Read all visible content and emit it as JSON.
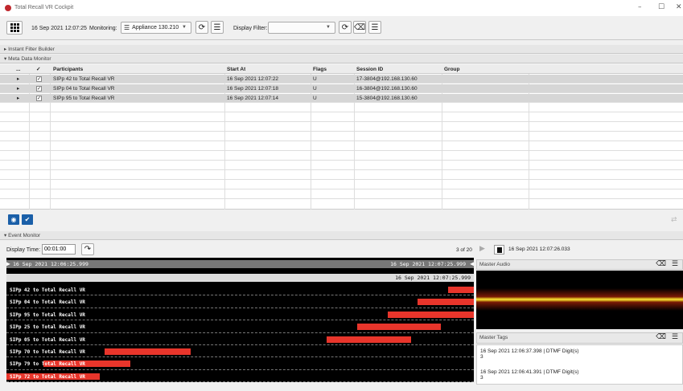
{
  "window": {
    "title": "Total Recall VR Cockpit",
    "minimize": "–",
    "maximize": "☐",
    "close": "✕"
  },
  "toolbar": {
    "datetime": "16 Sep 2021 12:07:25",
    "monitoring_label": "Monitoring:",
    "monitoring_value": "Appliance 130.210",
    "display_filter_label": "Display Filter:",
    "display_filter_value": ""
  },
  "sections": {
    "instant_filter": "Instant Filter Builder",
    "meta_monitor": "Meta Data Monitor",
    "event_monitor": "Event Monitor"
  },
  "table": {
    "headers": {
      "dots": "...",
      "check": "✓",
      "participants": "Participants",
      "start": "Start At",
      "flags": "Flags",
      "session": "Session ID",
      "group": "Group"
    },
    "rows": [
      {
        "expand": "▸",
        "check": "✓",
        "participants": "SIPp 42 to Total Recall VR",
        "start": "16 Sep 2021 12:07:22",
        "flags": "U",
        "session": "17-3804@192.168.130.60",
        "group": ""
      },
      {
        "expand": "▸",
        "check": "✓",
        "participants": "SIPp 04 to Total Recall VR",
        "start": "16 Sep 2021 12:07:18",
        "flags": "U",
        "session": "16-3804@192.168.130.60",
        "group": ""
      },
      {
        "expand": "▸",
        "check": "✓",
        "participants": "SIPp 95 to Total Recall VR",
        "start": "16 Sep 2021 12:07:14",
        "flags": "U",
        "session": "15-3804@192.168.130.60",
        "group": ""
      }
    ]
  },
  "event_monitor": {
    "display_time_label": "Display Time:",
    "display_time_value": "00:01:00",
    "paging": "3 of 20",
    "play_time": "16 Sep 2021 12:07:26.033",
    "tl_start": "16 Sep 2021 12:06:25.999",
    "tl_end": "16 Sep 2021 12:07:25.999",
    "tl_end2": "16 Sep 2021 12:07:25.999",
    "calls": [
      {
        "label": "SIPp 42 to Total Recall VR",
        "bar_start": 0.945,
        "bar_end": 1.0
      },
      {
        "label": "SIPp 04 to Total Recall VR",
        "bar_start": 0.88,
        "bar_end": 1.0
      },
      {
        "label": "SIPp 95 to Total Recall VR",
        "bar_start": 0.815,
        "bar_end": 1.0
      },
      {
        "label": "SIPp 25 to Total Recall VR",
        "bar_start": 0.75,
        "bar_end": 0.93
      },
      {
        "label": "SIPp 05 to Total Recall VR",
        "bar_start": 0.685,
        "bar_end": 0.865
      },
      {
        "label": "SIPp 70 to Total Recall VR",
        "bar_start": 0.21,
        "bar_end": 0.395
      },
      {
        "label": "SIPp 79 to Total Recall VR",
        "bar_start": 0.08,
        "bar_end": 0.265
      },
      {
        "label": "SIPp 72 to Total Recall VR",
        "bar_start": 0.0,
        "bar_end": 0.2
      }
    ]
  },
  "master_audio": {
    "title": "Master Audio"
  },
  "master_tags": {
    "title": "Master Tags",
    "tags": [
      {
        "text": "16 Sep 2021 12:06:37.398 | DTMF Digit(s)",
        "value": "3"
      },
      {
        "text": "16 Sep 2021 12:06:41.391 | DTMF Digit(s)",
        "value": "3"
      }
    ]
  },
  "colors": {
    "accent": "#1a5fa8",
    "call_bar": "#e8352b",
    "logo": "#c0272d"
  }
}
